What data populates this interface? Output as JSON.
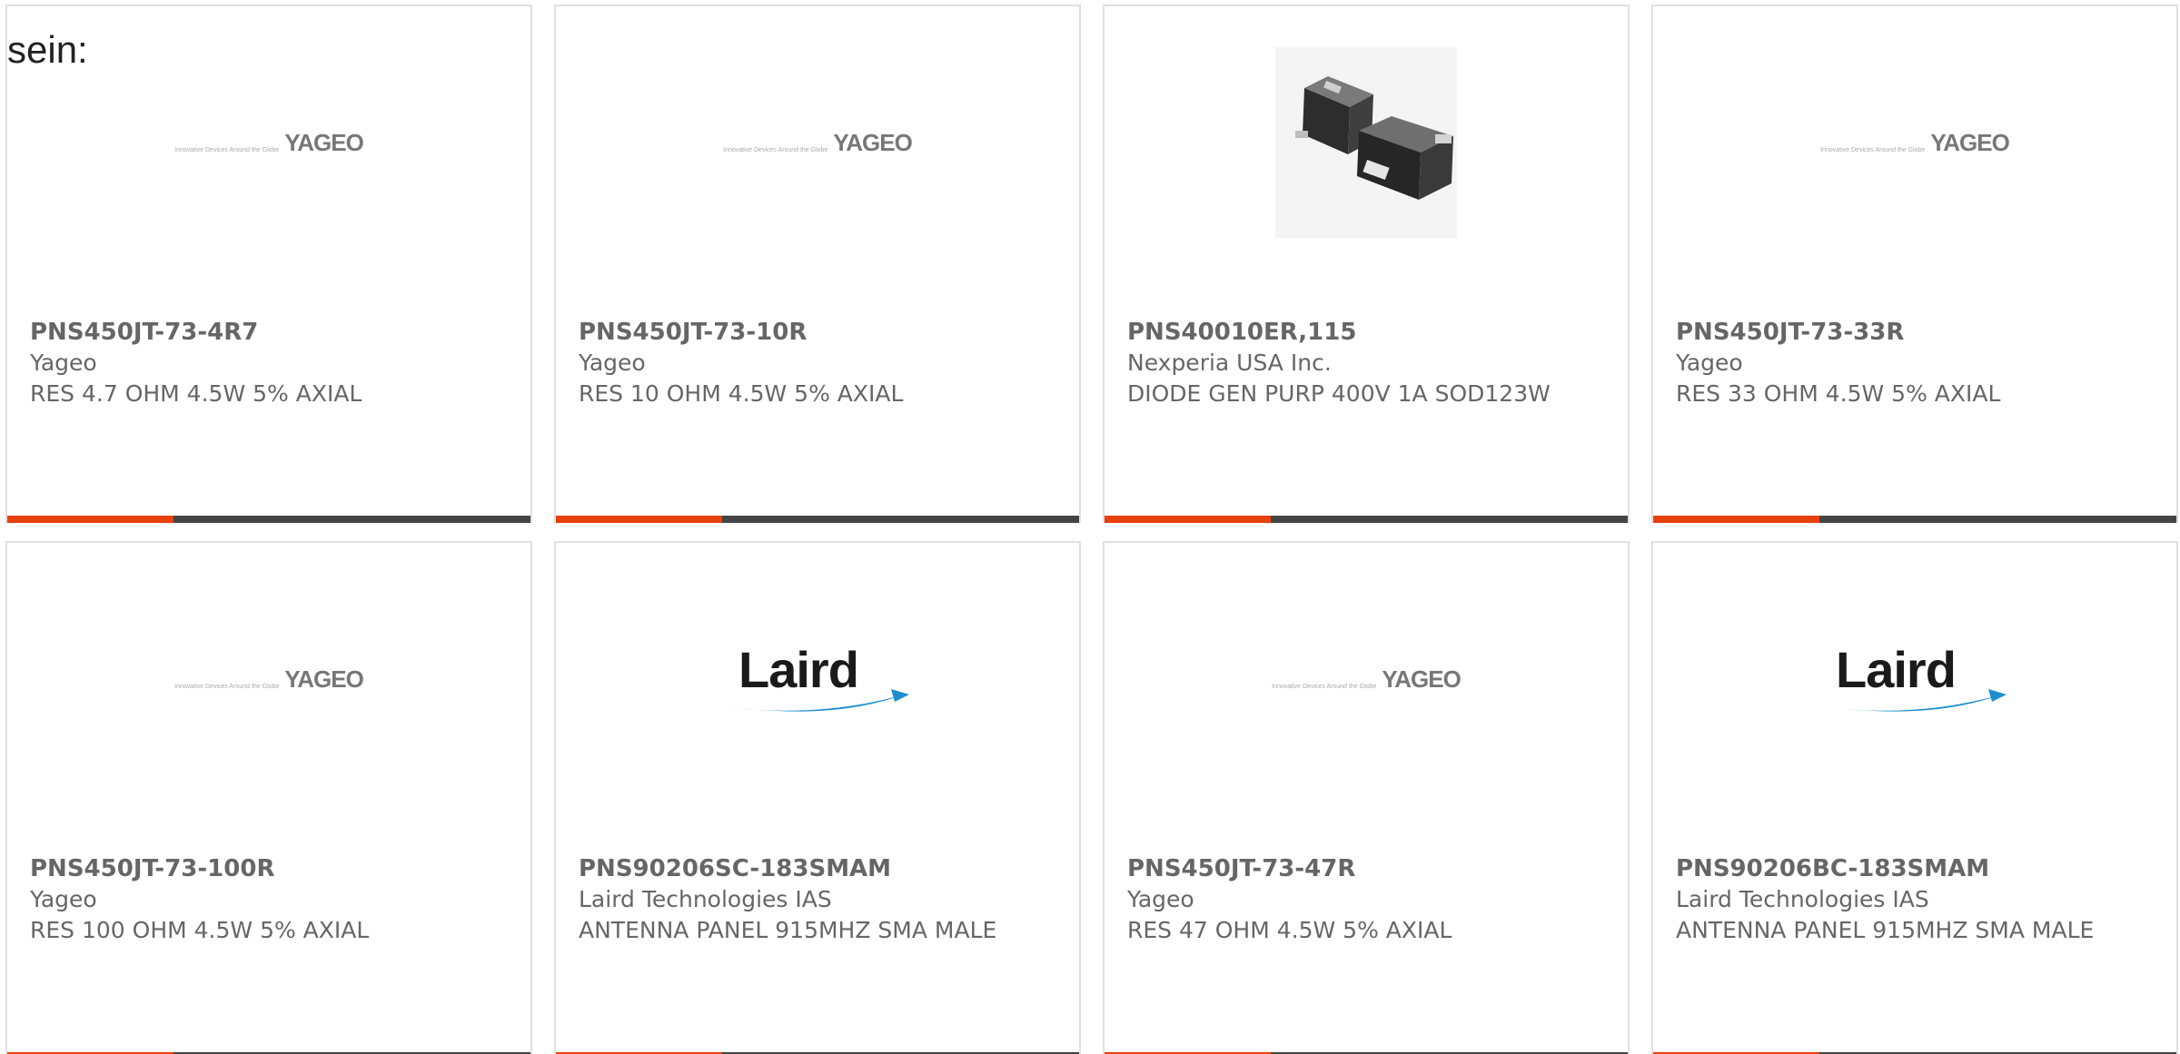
{
  "intro": {
    "text": "sein:"
  },
  "colors": {
    "accent": "#e8410c",
    "bar": "#444444",
    "text": "#666666",
    "border": "#e0e0e0",
    "laird_blue": "#1c8ed0"
  },
  "products": [
    {
      "part_number": "PNS450JT-73-4R7",
      "manufacturer": "Yageo",
      "description": "RES 4.7 OHM 4.5W 5% AXIAL",
      "image": "yageo-logo",
      "logo_tagline": "Innovative Devices Around the Globe",
      "logo_word": "YAGEO"
    },
    {
      "part_number": "PNS450JT-73-10R",
      "manufacturer": "Yageo",
      "description": "RES 10 OHM 4.5W 5% AXIAL",
      "image": "yageo-logo",
      "logo_tagline": "Innovative Devices Around the Globe",
      "logo_word": "YAGEO"
    },
    {
      "part_number": "PNS40010ER,115",
      "manufacturer": "Nexperia USA Inc.",
      "description": "DIODE GEN PURP 400V 1A SOD123W",
      "image": "diode-package-photo",
      "logo_tagline": "",
      "logo_word": ""
    },
    {
      "part_number": "PNS450JT-73-33R",
      "manufacturer": "Yageo",
      "description": "RES 33 OHM 4.5W 5% AXIAL",
      "image": "yageo-logo",
      "logo_tagline": "Innovative Devices Around the Globe",
      "logo_word": "YAGEO"
    },
    {
      "part_number": "PNS450JT-73-100R",
      "manufacturer": "Yageo",
      "description": "RES 100 OHM 4.5W 5% AXIAL",
      "image": "yageo-logo",
      "logo_tagline": "Innovative Devices Around the Globe",
      "logo_word": "YAGEO"
    },
    {
      "part_number": "PNS90206SC-183SMAM",
      "manufacturer": "Laird Technologies IAS",
      "description": "ANTENNA PANEL 915MHZ SMA MALE",
      "image": "laird-logo",
      "logo_tagline": "",
      "logo_word": "Laird"
    },
    {
      "part_number": "PNS450JT-73-47R",
      "manufacturer": "Yageo",
      "description": "RES 47 OHM 4.5W 5% AXIAL",
      "image": "yageo-logo",
      "logo_tagline": "Innovative Devices Around the Globe",
      "logo_word": "YAGEO"
    },
    {
      "part_number": "PNS90206BC-183SMAM",
      "manufacturer": "Laird Technologies IAS",
      "description": "ANTENNA PANEL 915MHZ SMA MALE",
      "image": "laird-logo",
      "logo_tagline": "",
      "logo_word": "Laird"
    }
  ]
}
